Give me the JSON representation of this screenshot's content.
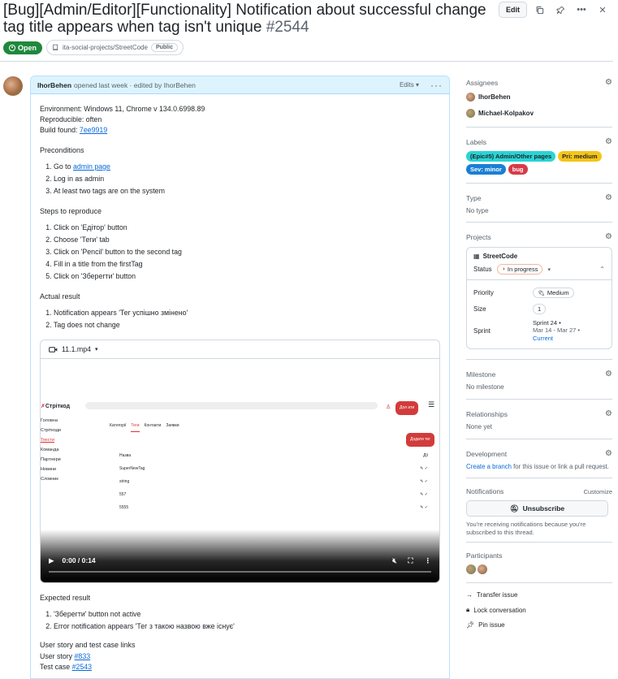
{
  "issue": {
    "title": "[Bug][Admin/Editor][Functionality] Notification about successful change tag title appears when tag isn't unique",
    "number": "#2544",
    "edit_label": "Edit",
    "state": "Open",
    "repo": "ita-social-projects/StreetCode",
    "visibility": "Public"
  },
  "comment": {
    "author": "IhorBehen",
    "meta": "opened last week · edited by IhorBehen",
    "edits_label": "Edits",
    "env": "Environment: Windows 11, Chrome v 134.0.6998.89",
    "repro": "Reproducible: often",
    "build_prefix": "Build found: ",
    "build_link": "7ee9919",
    "preconditions_title": "Preconditions",
    "pre1_prefix": "Go to ",
    "pre1_link": "admin page",
    "pre2": "Log in as admin",
    "pre3": "At least two tags are on the system",
    "steps_title": "Steps to reproduce",
    "steps": [
      "Click on 'Едітор' button",
      "Choose 'Теги' tab",
      "Click on 'Pencil' button to the second tag",
      "Fill in a title from the firstTag",
      "Click on 'Зберегти' button"
    ],
    "actual_title": "Actual result",
    "actual": [
      "Notification appears 'Тег успішно змінено'",
      "Tag does not change"
    ],
    "video_name": "11.1.mp4",
    "video_time": "0:00 / 0:14",
    "video_ui": {
      "logo": "Стріткод",
      "donate": "Дол ати",
      "side": [
        "Головна",
        "Стріткоди",
        "Тексти",
        "Команда",
        "Партнери",
        "Новини",
        "Словник"
      ],
      "tabs": [
        "Категорії",
        "Теги",
        "Контакти",
        "Заявки"
      ],
      "add": "Додати тег",
      "col1": "Назва",
      "col2": "Дії",
      "rows": [
        "SuperNewTag",
        "string",
        "557",
        "5555"
      ]
    },
    "expected_title": "Expected result",
    "expected": [
      "'Зберегти' button not active",
      "Error notification appears 'Тег з такою назвою вже існує'"
    ],
    "links_title": "User story and test case links",
    "user_story_prefix": "User story ",
    "user_story_link": "#833",
    "test_case_prefix": "Test case ",
    "test_case_link": "#2543"
  },
  "sidebar": {
    "assignees_title": "Assignees",
    "assignees": [
      "IhorBehen",
      "Michael-Kolpakov"
    ],
    "labels_title": "Labels",
    "labels": [
      {
        "name": "(Epic#5) Admin/Other pages",
        "bg": "#2ad4d4",
        "fg": "#1f2328"
      },
      {
        "name": "Pri: medium",
        "bg": "#f5c518",
        "fg": "#1f2328"
      },
      {
        "name": "Sev: minor",
        "bg": "#1a7fd4",
        "fg": "#ffffff"
      },
      {
        "name": "bug",
        "bg": "#d73a4a",
        "fg": "#ffffff"
      }
    ],
    "type_title": "Type",
    "type_value": "No type",
    "projects_title": "Projects",
    "project_name": "StreetCode",
    "status_label": "Status",
    "status_value": "In progress",
    "priority_label": "Priority",
    "priority_value": "Medium",
    "size_label": "Size",
    "size_value": "1",
    "sprint_label": "Sprint",
    "sprint_name": "Sprint 24 •",
    "sprint_dates": "Mar 14 - Mar 27 •",
    "sprint_current": "Current",
    "milestone_title": "Milestone",
    "milestone_value": "No milestone",
    "relationships_title": "Relationships",
    "relationships_value": "None yet",
    "development_title": "Development",
    "dev_link": "Create a branch",
    "dev_text": " for this issue or link a pull request.",
    "notifications_title": "Notifications",
    "customize": "Customize",
    "unsubscribe": "Unsubscribe",
    "notif_text": "You're receiving notifications because you're subscribed to this thread.",
    "participants_title": "Participants",
    "actions": [
      "Transfer issue",
      "Lock conversation",
      "Pin issue"
    ]
  }
}
